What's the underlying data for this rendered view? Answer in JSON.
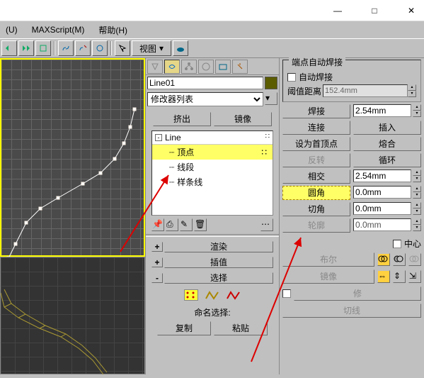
{
  "window": {
    "minimize": "—",
    "maximize": "□",
    "close": "✕"
  },
  "menu": {
    "item_u": "(U)",
    "maxscript": "MAXScript(M)",
    "help": "帮助(H)"
  },
  "toolbar": {
    "view_label": "视图"
  },
  "mid": {
    "name_value": "Line01",
    "modifier_list": "修改器列表",
    "extrude": "挤出",
    "mirror": "镜像",
    "tree_root": "Line",
    "tree_items": [
      "顶点",
      "线段",
      "样条线"
    ],
    "rollups": {
      "render": "渲染",
      "interpolate": "插值",
      "select": "选择"
    },
    "naming_label": "命名选择:",
    "copy": "复制",
    "paste": "粘贴"
  },
  "right": {
    "group_title": "端点自动焊接",
    "auto_weld": "自动焊接",
    "threshold_label": "阈值距离",
    "threshold_value": "152.4mm",
    "buttons": {
      "weld": "焊接",
      "connect": "连接",
      "insert": "插入",
      "make_first": "设为首顶点",
      "fuse": "熔合",
      "reverse": "反转",
      "cycle": "循环",
      "crossins": "相交",
      "fillet": "圆角",
      "chamfer": "切角",
      "outline": "轮廓"
    },
    "values": {
      "weld_val": "2.54mm",
      "cross_val": "2.54mm",
      "fillet_val": "0.0mm",
      "chamfer_val": "0.0mm",
      "outline_val": "0.0mm"
    },
    "center": "中心",
    "boolean": "布尔",
    "mirror_btn": "镜像",
    "trim": "修",
    "cut": "切线"
  }
}
